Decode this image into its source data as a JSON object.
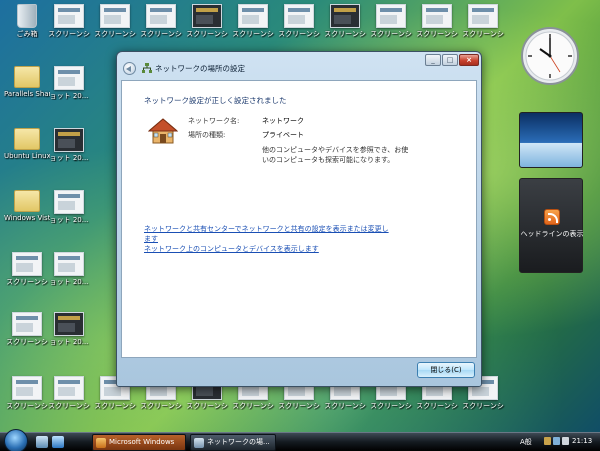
{
  "desktop": {
    "recycle_bin_label": "ごみ箱",
    "parallels_label": "Parallels Share...",
    "ubuntu_label": "Ubuntu Linux 16....",
    "windows_vista_label": "Windows Vista",
    "screenshot_label_a": "スクリーンシ",
    "screenshot_label_b": "ョット 20..."
  },
  "dialog": {
    "title": "ネットワークの場所の設定",
    "status_heading": "ネットワーク設定が正しく設定されました",
    "network_name_key": "ネットワーク名:",
    "network_name_value": "ネットワーク",
    "location_type_key": "場所の種類:",
    "location_type_value": "プライベート",
    "description": "他のコンピュータやデバイスを参照でき、お使いのコンピュータも探索可能になります。",
    "link_sharing_center": "ネットワークと共有センターでネットワークと共有の設定を表示または変更します",
    "link_view_devices": "ネットワーク上のコンピュータとデバイスを表示します",
    "close_button_label": "閉じる(C)"
  },
  "gadgets": {
    "feed_label": "ヘッドラインの表示"
  },
  "taskbar": {
    "task1_label": "Microsoft Windows",
    "task2_label": "ネットワークの場...",
    "ime_label": "A般",
    "time": "21:13"
  },
  "colors": {
    "link": "#1a4fb4",
    "heading": "#1c3a6e",
    "close_button_border": "#3c7fb1"
  }
}
